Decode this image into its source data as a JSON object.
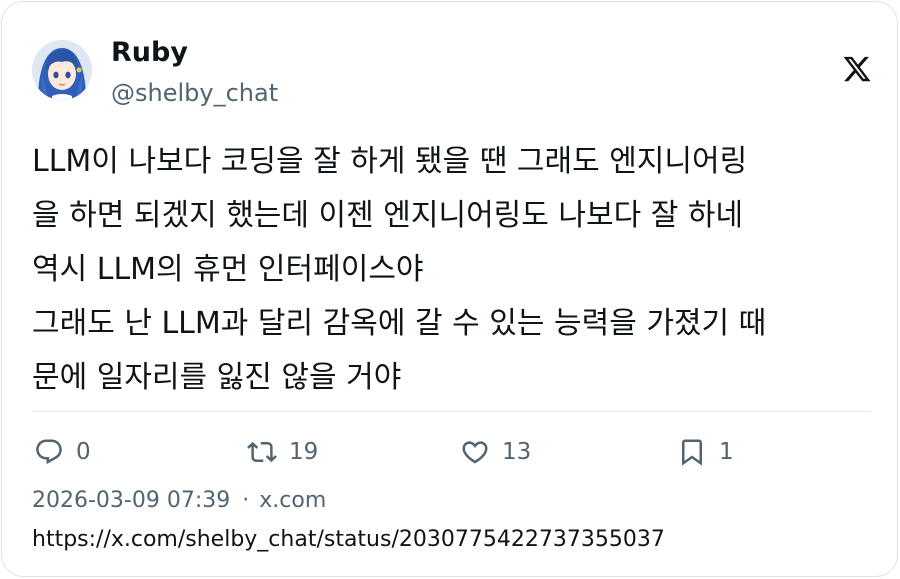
{
  "author": {
    "display_name": "Ruby",
    "handle": "@shelby_chat",
    "avatar_icon": "anime-avatar-icon"
  },
  "platform_icon": "x-logo-icon",
  "tweet": {
    "lines": [
      "LLM이 나보다 코딩을 잘 하게 됐을 땐 그래도 엔지니어링",
      "을 하면 되겠지 했는데 이젠 엔지니어링도 나보다 잘 하네",
      "역시 LLM의 휴먼 인터페이스야",
      "그래도 난 LLM과 달리 감옥에 갈 수 있는 능력을 가졌기 때",
      "문에 일자리를 잃진 않을 거야"
    ]
  },
  "stats": {
    "replies": "0",
    "retweets": "19",
    "likes": "13",
    "bookmarks": "1"
  },
  "meta": {
    "timestamp": "2026-03-09 07:39",
    "separator": "·",
    "source": "x.com"
  },
  "url": "https://x.com/shelby_chat/status/2030775422737355037",
  "colors": {
    "text_primary": "#0f1419",
    "text_secondary": "#536471",
    "border": "#dfe3e6"
  }
}
